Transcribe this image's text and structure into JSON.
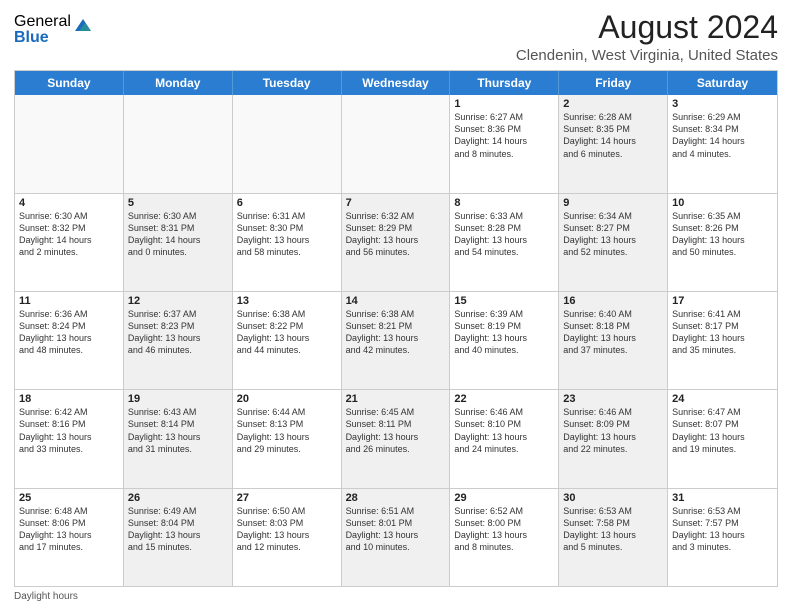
{
  "logo": {
    "general": "General",
    "blue": "Blue"
  },
  "title": "August 2024",
  "subtitle": "Clendenin, West Virginia, United States",
  "days": [
    "Sunday",
    "Monday",
    "Tuesday",
    "Wednesday",
    "Thursday",
    "Friday",
    "Saturday"
  ],
  "footer": "Daylight hours",
  "weeks": [
    [
      {
        "day": "",
        "content": "",
        "empty": true
      },
      {
        "day": "",
        "content": "",
        "empty": true
      },
      {
        "day": "",
        "content": "",
        "empty": true
      },
      {
        "day": "",
        "content": "",
        "empty": true
      },
      {
        "day": "1",
        "content": "Sunrise: 6:27 AM\nSunset: 8:36 PM\nDaylight: 14 hours\nand 8 minutes."
      },
      {
        "day": "2",
        "content": "Sunrise: 6:28 AM\nSunset: 8:35 PM\nDaylight: 14 hours\nand 6 minutes.",
        "shaded": true
      },
      {
        "day": "3",
        "content": "Sunrise: 6:29 AM\nSunset: 8:34 PM\nDaylight: 14 hours\nand 4 minutes."
      }
    ],
    [
      {
        "day": "4",
        "content": "Sunrise: 6:30 AM\nSunset: 8:32 PM\nDaylight: 14 hours\nand 2 minutes."
      },
      {
        "day": "5",
        "content": "Sunrise: 6:30 AM\nSunset: 8:31 PM\nDaylight: 14 hours\nand 0 minutes.",
        "shaded": true
      },
      {
        "day": "6",
        "content": "Sunrise: 6:31 AM\nSunset: 8:30 PM\nDaylight: 13 hours\nand 58 minutes."
      },
      {
        "day": "7",
        "content": "Sunrise: 6:32 AM\nSunset: 8:29 PM\nDaylight: 13 hours\nand 56 minutes.",
        "shaded": true
      },
      {
        "day": "8",
        "content": "Sunrise: 6:33 AM\nSunset: 8:28 PM\nDaylight: 13 hours\nand 54 minutes."
      },
      {
        "day": "9",
        "content": "Sunrise: 6:34 AM\nSunset: 8:27 PM\nDaylight: 13 hours\nand 52 minutes.",
        "shaded": true
      },
      {
        "day": "10",
        "content": "Sunrise: 6:35 AM\nSunset: 8:26 PM\nDaylight: 13 hours\nand 50 minutes."
      }
    ],
    [
      {
        "day": "11",
        "content": "Sunrise: 6:36 AM\nSunset: 8:24 PM\nDaylight: 13 hours\nand 48 minutes."
      },
      {
        "day": "12",
        "content": "Sunrise: 6:37 AM\nSunset: 8:23 PM\nDaylight: 13 hours\nand 46 minutes.",
        "shaded": true
      },
      {
        "day": "13",
        "content": "Sunrise: 6:38 AM\nSunset: 8:22 PM\nDaylight: 13 hours\nand 44 minutes."
      },
      {
        "day": "14",
        "content": "Sunrise: 6:38 AM\nSunset: 8:21 PM\nDaylight: 13 hours\nand 42 minutes.",
        "shaded": true
      },
      {
        "day": "15",
        "content": "Sunrise: 6:39 AM\nSunset: 8:19 PM\nDaylight: 13 hours\nand 40 minutes."
      },
      {
        "day": "16",
        "content": "Sunrise: 6:40 AM\nSunset: 8:18 PM\nDaylight: 13 hours\nand 37 minutes.",
        "shaded": true
      },
      {
        "day": "17",
        "content": "Sunrise: 6:41 AM\nSunset: 8:17 PM\nDaylight: 13 hours\nand 35 minutes."
      }
    ],
    [
      {
        "day": "18",
        "content": "Sunrise: 6:42 AM\nSunset: 8:16 PM\nDaylight: 13 hours\nand 33 minutes."
      },
      {
        "day": "19",
        "content": "Sunrise: 6:43 AM\nSunset: 8:14 PM\nDaylight: 13 hours\nand 31 minutes.",
        "shaded": true
      },
      {
        "day": "20",
        "content": "Sunrise: 6:44 AM\nSunset: 8:13 PM\nDaylight: 13 hours\nand 29 minutes."
      },
      {
        "day": "21",
        "content": "Sunrise: 6:45 AM\nSunset: 8:11 PM\nDaylight: 13 hours\nand 26 minutes.",
        "shaded": true
      },
      {
        "day": "22",
        "content": "Sunrise: 6:46 AM\nSunset: 8:10 PM\nDaylight: 13 hours\nand 24 minutes."
      },
      {
        "day": "23",
        "content": "Sunrise: 6:46 AM\nSunset: 8:09 PM\nDaylight: 13 hours\nand 22 minutes.",
        "shaded": true
      },
      {
        "day": "24",
        "content": "Sunrise: 6:47 AM\nSunset: 8:07 PM\nDaylight: 13 hours\nand 19 minutes."
      }
    ],
    [
      {
        "day": "25",
        "content": "Sunrise: 6:48 AM\nSunset: 8:06 PM\nDaylight: 13 hours\nand 17 minutes."
      },
      {
        "day": "26",
        "content": "Sunrise: 6:49 AM\nSunset: 8:04 PM\nDaylight: 13 hours\nand 15 minutes.",
        "shaded": true
      },
      {
        "day": "27",
        "content": "Sunrise: 6:50 AM\nSunset: 8:03 PM\nDaylight: 13 hours\nand 12 minutes."
      },
      {
        "day": "28",
        "content": "Sunrise: 6:51 AM\nSunset: 8:01 PM\nDaylight: 13 hours\nand 10 minutes.",
        "shaded": true
      },
      {
        "day": "29",
        "content": "Sunrise: 6:52 AM\nSunset: 8:00 PM\nDaylight: 13 hours\nand 8 minutes."
      },
      {
        "day": "30",
        "content": "Sunrise: 6:53 AM\nSunset: 7:58 PM\nDaylight: 13 hours\nand 5 minutes.",
        "shaded": true
      },
      {
        "day": "31",
        "content": "Sunrise: 6:53 AM\nSunset: 7:57 PM\nDaylight: 13 hours\nand 3 minutes."
      }
    ]
  ]
}
